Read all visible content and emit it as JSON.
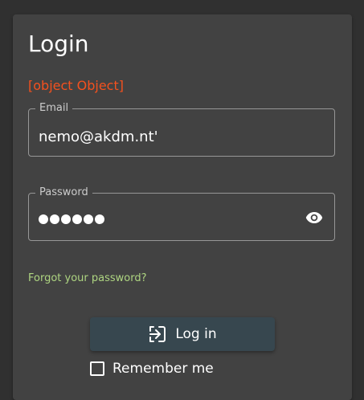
{
  "login": {
    "title": "Login",
    "error": "[object Object]",
    "email": {
      "label": "Email",
      "value": "nemo@akdm.nt'"
    },
    "password": {
      "label": "Password",
      "masked_count": 6,
      "toggle_icon": "eye-icon"
    },
    "forgot_link": "Forgot your password?",
    "login_button": {
      "label": "Log in",
      "icon": "login-icon"
    },
    "remember_me": {
      "label": "Remember me",
      "checked": false
    }
  },
  "colors": {
    "background": "#303030",
    "card": "#424242",
    "error": "#f4511e",
    "link": "#aed581",
    "button": "#37474f"
  }
}
